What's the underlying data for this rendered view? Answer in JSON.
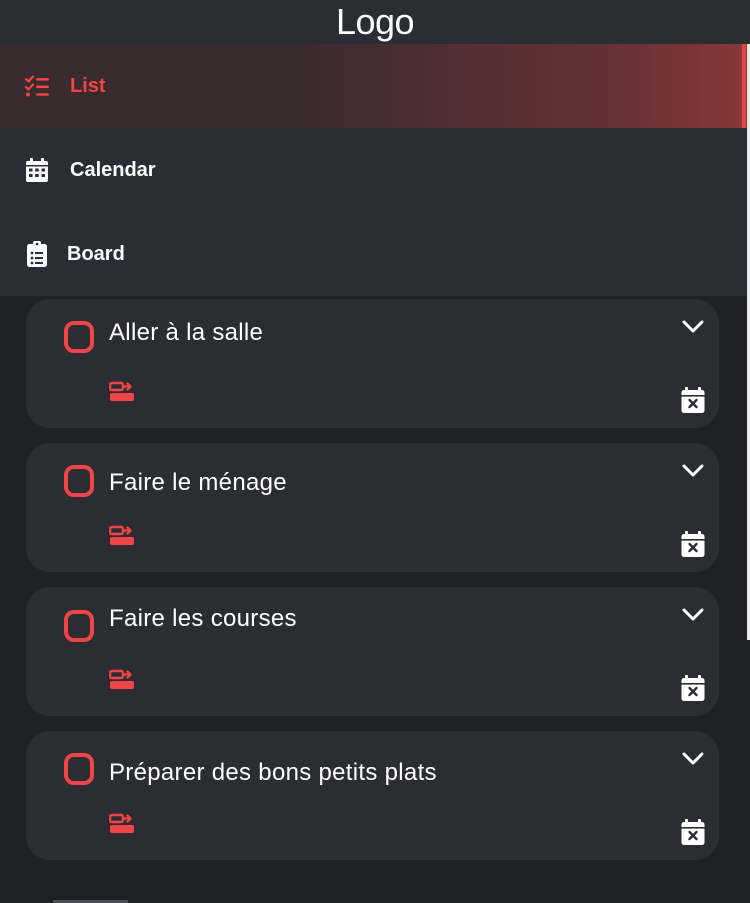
{
  "header": {
    "logo": "Logo"
  },
  "nav": {
    "items": [
      {
        "label": "List",
        "icon": "checklist-icon",
        "active": true
      },
      {
        "label": "Calendar",
        "icon": "calendar-icon",
        "active": false
      },
      {
        "label": "Board",
        "icon": "clipboard-icon",
        "active": false
      }
    ]
  },
  "tasks": [
    {
      "title": "Aller à la salle"
    },
    {
      "title": "Faire le ménage"
    },
    {
      "title": "Faire les courses"
    },
    {
      "title": "Préparer des bons petits plats"
    }
  ],
  "colors": {
    "accent": "#ef4546",
    "background": "#1f2125",
    "panel": "#2a2d33",
    "card": "#2b2d33",
    "text": "#ffffff"
  }
}
